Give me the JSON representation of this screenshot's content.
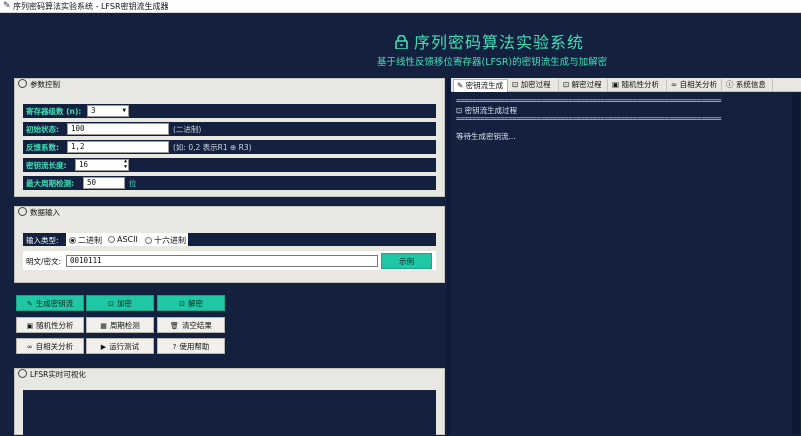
{
  "window": {
    "title": "序列密码算法实验系统 - LFSR密钥流生成器"
  },
  "header": {
    "title": "序列密码算法实验系统",
    "subtitle": "基于线性反馈移位寄存器(LFSR)的密钥流生成与加解密"
  },
  "params": {
    "title": "参数控制",
    "stages_label": "寄存器级数 (n):",
    "stages_value": "3",
    "init_label": "初始状态:",
    "init_value": "100",
    "init_hint": "(二进制)",
    "fb_label": "反馈系数:",
    "fb_value": "1,2",
    "fb_hint": "(如: 0,2 表示R1 ⊕ R3)",
    "len_label": "密钥流长度:",
    "len_value": "16",
    "period_label": "最大周期检测:",
    "period_value": "50",
    "period_unit": "位"
  },
  "input": {
    "title": "数据输入",
    "type_label": "输入类型:",
    "types": [
      "二进制",
      "ASCII",
      "十六进制"
    ],
    "selected_type": "二进制",
    "text_label": "明文/密文:",
    "text_value": "0010111",
    "example_button": "示例"
  },
  "actions": {
    "generate": "生成密钥流",
    "encrypt": "加密",
    "decrypt": "解密",
    "randomness": "随机性分析",
    "period": "周期检测",
    "clear": "清空结果",
    "autocorr": "自相关分析",
    "test": "运行测试",
    "help": "使用帮助"
  },
  "viz": {
    "title": "LFSR实时可视化"
  },
  "tabs": [
    "密钥流生成",
    "加密过程",
    "解密过程",
    "随机性分析",
    "自相关分析",
    "系统信息"
  ],
  "output": {
    "separator": "==================================================================",
    "heading": "密钥流生成过程",
    "status": "等待生成密钥流..."
  },
  "colors": {
    "accent": "#3fe0b6",
    "navy": "#13213f",
    "panel": "#e9e7e2",
    "button_teal": "#20c7a4"
  },
  "icons": [
    "pen-icon",
    "lock-icon",
    "unlock-icon",
    "chart-icon",
    "calendar-icon",
    "trash-icon",
    "link-icon",
    "play-icon",
    "question-icon",
    "gear-icon",
    "info-icon"
  ]
}
